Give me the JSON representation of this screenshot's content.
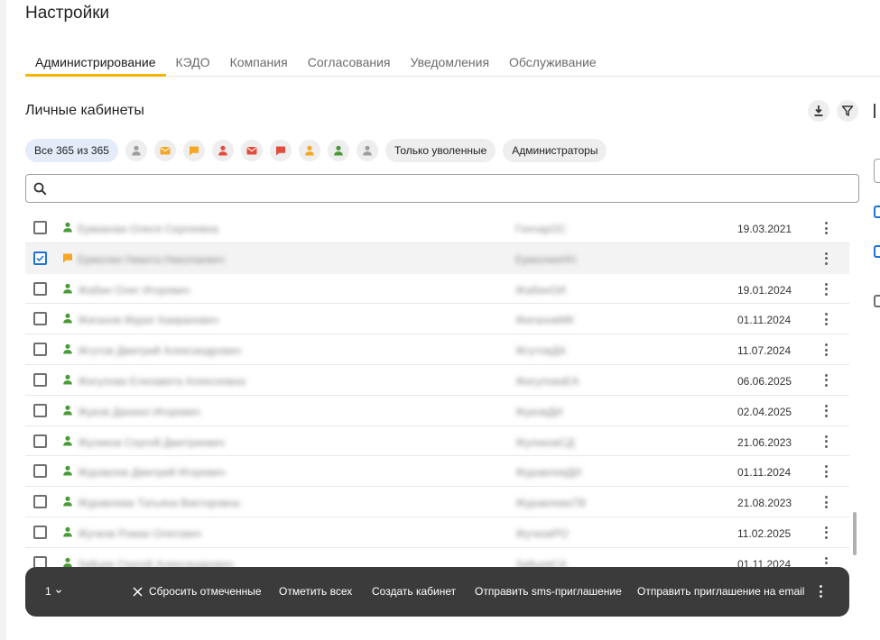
{
  "page": {
    "title": "Настройки"
  },
  "tabs": [
    {
      "label": "Администрирование",
      "active": true
    },
    {
      "label": "КЭДО",
      "active": false
    },
    {
      "label": "Компания",
      "active": false
    },
    {
      "label": "Согласования",
      "active": false
    },
    {
      "label": "Уведомления",
      "active": false
    },
    {
      "label": "Обслуживание",
      "active": false
    }
  ],
  "section": {
    "title": "Личные кабинеты"
  },
  "toolbar": {
    "download_icon": "download-icon",
    "filter_icon": "filter-icon"
  },
  "filters": {
    "all_label": "Все 365 из 365",
    "icon_filters": [
      {
        "icon": "person-icon",
        "color": "#9e9e9e"
      },
      {
        "icon": "email-icon",
        "color": "#f5a623"
      },
      {
        "icon": "message-icon",
        "color": "#f5a623"
      },
      {
        "icon": "person-icon",
        "color": "#e24d3d"
      },
      {
        "icon": "email-icon",
        "color": "#e24d3d"
      },
      {
        "icon": "message-icon",
        "color": "#e24d3d"
      },
      {
        "icon": "person-icon",
        "color": "#f5a623"
      },
      {
        "icon": "person-icon",
        "color": "#4a9a3a"
      },
      {
        "icon": "person-icon",
        "color": "#9e9e9e"
      }
    ],
    "fired_label": "Только уволенные",
    "admins_label": "Администраторы"
  },
  "search": {
    "placeholder": "",
    "value": ""
  },
  "rows": [
    {
      "name": "Ермакова Олеся Сергеевна",
      "login": "ГончарОС",
      "date": "19.03.2021",
      "checked": false,
      "status_icon": "person-icon",
      "status_color": "#4a9a3a"
    },
    {
      "name": "Ермолин Никита Николаевич",
      "login": "ЕрмолинНН",
      "date": "",
      "checked": true,
      "status_icon": "message-icon",
      "status_color": "#f5a623"
    },
    {
      "name": "Жабин Олег Игоревич",
      "login": "ЖабинОИ",
      "date": "19.01.2024",
      "checked": false,
      "status_icon": "person-icon",
      "status_color": "#4a9a3a"
    },
    {
      "name": "Жиганов Мурат Каиранович",
      "login": "ЖигановМК",
      "date": "01.11.2024",
      "checked": false,
      "status_icon": "person-icon",
      "status_color": "#4a9a3a"
    },
    {
      "name": "Жгутов Дмитрий Александрович",
      "login": "ЖгутовДА",
      "date": "11.07.2024",
      "checked": false,
      "status_icon": "person-icon",
      "status_color": "#4a9a3a"
    },
    {
      "name": "Жигулова Елизавета Алексеевна",
      "login": "ЖигуловаЕА",
      "date": "06.06.2025",
      "checked": false,
      "status_icon": "person-icon",
      "status_color": "#4a9a3a"
    },
    {
      "name": "Жуков Даниил Игоревич",
      "login": "ЖуковДИ",
      "date": "02.04.2025",
      "checked": false,
      "status_icon": "person-icon",
      "status_color": "#4a9a3a"
    },
    {
      "name": "Жуликов Сергей Дмитриевич",
      "login": "ЖуликовСД",
      "date": "21.06.2023",
      "checked": false,
      "status_icon": "person-icon",
      "status_color": "#4a9a3a"
    },
    {
      "name": "Журавлев Дмитрий Игоревич",
      "login": "ЖуравлевДИ",
      "date": "01.11.2024",
      "checked": false,
      "status_icon": "person-icon",
      "status_color": "#4a9a3a"
    },
    {
      "name": "Журавлева Татьяна Викторовна",
      "login": "ЖуравлеваТВ",
      "date": "21.08.2023",
      "checked": false,
      "status_icon": "person-icon",
      "status_color": "#4a9a3a"
    },
    {
      "name": "Жучков Роман Олегович",
      "login": "ЖучковРО",
      "date": "11.02.2025",
      "checked": false,
      "status_icon": "person-icon",
      "status_color": "#4a9a3a"
    },
    {
      "name": "Зайцев Сергей Александрович",
      "login": "ЗайцевСА",
      "date": "01.11.2024",
      "checked": false,
      "status_icon": "person-icon",
      "status_color": "#4a9a3a"
    }
  ],
  "action_bar": {
    "count": "1",
    "reset_label": "Сбросить отмеченные",
    "select_all_label": "Отметить всех",
    "create_label": "Создать кабинет",
    "sms_label": "Отправить sms-приглашение",
    "email_label": "Отправить приглашение на email"
  },
  "colors": {
    "accent": "#f5b400",
    "checkbox_checked": "#1e73d8",
    "action_bar_bg": "#3b3b3b"
  }
}
